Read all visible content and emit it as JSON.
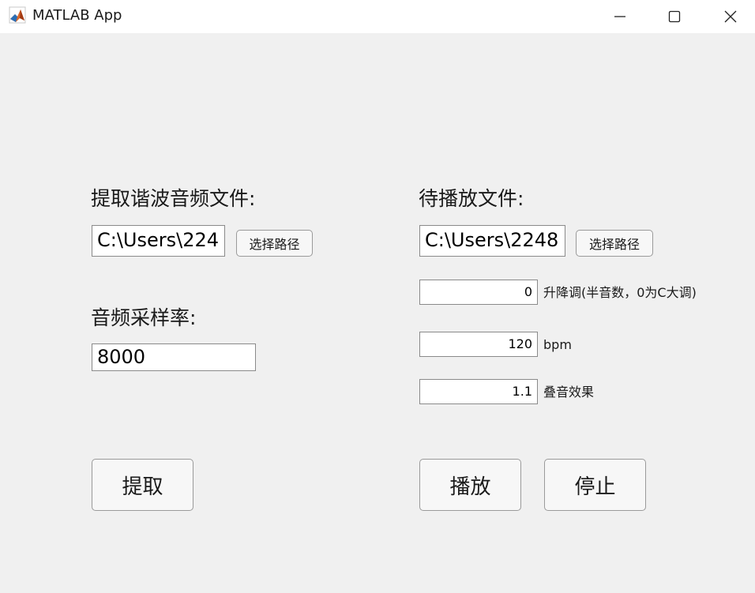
{
  "window": {
    "title": "MATLAB App",
    "app_icon": "matlab-logo-icon",
    "controls": [
      "minimize-icon",
      "maximize-icon",
      "close-icon"
    ]
  },
  "extract": {
    "file_label": "提取谐波音频文件:",
    "file_path_value": "C:\\Users\\224",
    "browse_button": "选择路径",
    "sample_rate_label": "音频采样率:",
    "sample_rate_value": "8000",
    "extract_button": "提取"
  },
  "play": {
    "file_label": "待播放文件:",
    "file_path_value": "C:\\Users\\2248",
    "browse_button": "选择路径",
    "transpose_value": "0",
    "transpose_label": "升降调(半音数，0为C大调)",
    "bpm_value": "120",
    "bpm_label": "bpm",
    "overlap_value": "1.1",
    "overlap_label": "叠音效果",
    "play_button": "播放",
    "stop_button": "停止"
  }
}
